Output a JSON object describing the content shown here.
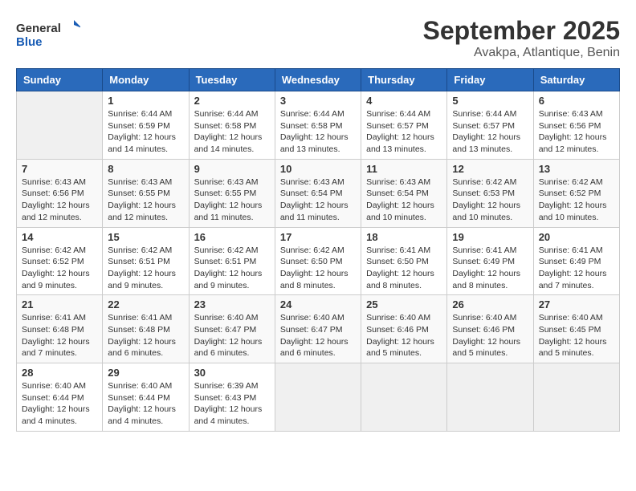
{
  "logo": {
    "line1": "General",
    "line2": "Blue"
  },
  "title": "September 2025",
  "location": "Avakpa, Atlantique, Benin",
  "weekdays": [
    "Sunday",
    "Monday",
    "Tuesday",
    "Wednesday",
    "Thursday",
    "Friday",
    "Saturday"
  ],
  "weeks": [
    [
      {
        "day": "",
        "info": ""
      },
      {
        "day": "1",
        "info": "Sunrise: 6:44 AM\nSunset: 6:59 PM\nDaylight: 12 hours\nand 14 minutes."
      },
      {
        "day": "2",
        "info": "Sunrise: 6:44 AM\nSunset: 6:58 PM\nDaylight: 12 hours\nand 14 minutes."
      },
      {
        "day": "3",
        "info": "Sunrise: 6:44 AM\nSunset: 6:58 PM\nDaylight: 12 hours\nand 13 minutes."
      },
      {
        "day": "4",
        "info": "Sunrise: 6:44 AM\nSunset: 6:57 PM\nDaylight: 12 hours\nand 13 minutes."
      },
      {
        "day": "5",
        "info": "Sunrise: 6:44 AM\nSunset: 6:57 PM\nDaylight: 12 hours\nand 13 minutes."
      },
      {
        "day": "6",
        "info": "Sunrise: 6:43 AM\nSunset: 6:56 PM\nDaylight: 12 hours\nand 12 minutes."
      }
    ],
    [
      {
        "day": "7",
        "info": "Sunrise: 6:43 AM\nSunset: 6:56 PM\nDaylight: 12 hours\nand 12 minutes."
      },
      {
        "day": "8",
        "info": "Sunrise: 6:43 AM\nSunset: 6:55 PM\nDaylight: 12 hours\nand 12 minutes."
      },
      {
        "day": "9",
        "info": "Sunrise: 6:43 AM\nSunset: 6:55 PM\nDaylight: 12 hours\nand 11 minutes."
      },
      {
        "day": "10",
        "info": "Sunrise: 6:43 AM\nSunset: 6:54 PM\nDaylight: 12 hours\nand 11 minutes."
      },
      {
        "day": "11",
        "info": "Sunrise: 6:43 AM\nSunset: 6:54 PM\nDaylight: 12 hours\nand 10 minutes."
      },
      {
        "day": "12",
        "info": "Sunrise: 6:42 AM\nSunset: 6:53 PM\nDaylight: 12 hours\nand 10 minutes."
      },
      {
        "day": "13",
        "info": "Sunrise: 6:42 AM\nSunset: 6:52 PM\nDaylight: 12 hours\nand 10 minutes."
      }
    ],
    [
      {
        "day": "14",
        "info": "Sunrise: 6:42 AM\nSunset: 6:52 PM\nDaylight: 12 hours\nand 9 minutes."
      },
      {
        "day": "15",
        "info": "Sunrise: 6:42 AM\nSunset: 6:51 PM\nDaylight: 12 hours\nand 9 minutes."
      },
      {
        "day": "16",
        "info": "Sunrise: 6:42 AM\nSunset: 6:51 PM\nDaylight: 12 hours\nand 9 minutes."
      },
      {
        "day": "17",
        "info": "Sunrise: 6:42 AM\nSunset: 6:50 PM\nDaylight: 12 hours\nand 8 minutes."
      },
      {
        "day": "18",
        "info": "Sunrise: 6:41 AM\nSunset: 6:50 PM\nDaylight: 12 hours\nand 8 minutes."
      },
      {
        "day": "19",
        "info": "Sunrise: 6:41 AM\nSunset: 6:49 PM\nDaylight: 12 hours\nand 8 minutes."
      },
      {
        "day": "20",
        "info": "Sunrise: 6:41 AM\nSunset: 6:49 PM\nDaylight: 12 hours\nand 7 minutes."
      }
    ],
    [
      {
        "day": "21",
        "info": "Sunrise: 6:41 AM\nSunset: 6:48 PM\nDaylight: 12 hours\nand 7 minutes."
      },
      {
        "day": "22",
        "info": "Sunrise: 6:41 AM\nSunset: 6:48 PM\nDaylight: 12 hours\nand 6 minutes."
      },
      {
        "day": "23",
        "info": "Sunrise: 6:40 AM\nSunset: 6:47 PM\nDaylight: 12 hours\nand 6 minutes."
      },
      {
        "day": "24",
        "info": "Sunrise: 6:40 AM\nSunset: 6:47 PM\nDaylight: 12 hours\nand 6 minutes."
      },
      {
        "day": "25",
        "info": "Sunrise: 6:40 AM\nSunset: 6:46 PM\nDaylight: 12 hours\nand 5 minutes."
      },
      {
        "day": "26",
        "info": "Sunrise: 6:40 AM\nSunset: 6:46 PM\nDaylight: 12 hours\nand 5 minutes."
      },
      {
        "day": "27",
        "info": "Sunrise: 6:40 AM\nSunset: 6:45 PM\nDaylight: 12 hours\nand 5 minutes."
      }
    ],
    [
      {
        "day": "28",
        "info": "Sunrise: 6:40 AM\nSunset: 6:44 PM\nDaylight: 12 hours\nand 4 minutes."
      },
      {
        "day": "29",
        "info": "Sunrise: 6:40 AM\nSunset: 6:44 PM\nDaylight: 12 hours\nand 4 minutes."
      },
      {
        "day": "30",
        "info": "Sunrise: 6:39 AM\nSunset: 6:43 PM\nDaylight: 12 hours\nand 4 minutes."
      },
      {
        "day": "",
        "info": ""
      },
      {
        "day": "",
        "info": ""
      },
      {
        "day": "",
        "info": ""
      },
      {
        "day": "",
        "info": ""
      }
    ]
  ]
}
